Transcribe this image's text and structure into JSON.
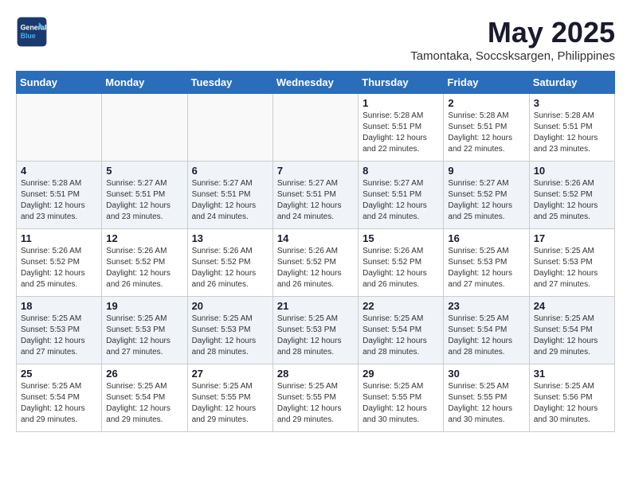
{
  "header": {
    "logo_line1": "General",
    "logo_line2": "Blue",
    "month": "May 2025",
    "location": "Tamontaka, Soccsksargen, Philippines"
  },
  "weekdays": [
    "Sunday",
    "Monday",
    "Tuesday",
    "Wednesday",
    "Thursday",
    "Friday",
    "Saturday"
  ],
  "weeks": [
    [
      {
        "day": "",
        "info": ""
      },
      {
        "day": "",
        "info": ""
      },
      {
        "day": "",
        "info": ""
      },
      {
        "day": "",
        "info": ""
      },
      {
        "day": "1",
        "info": "Sunrise: 5:28 AM\nSunset: 5:51 PM\nDaylight: 12 hours\nand 22 minutes."
      },
      {
        "day": "2",
        "info": "Sunrise: 5:28 AM\nSunset: 5:51 PM\nDaylight: 12 hours\nand 22 minutes."
      },
      {
        "day": "3",
        "info": "Sunrise: 5:28 AM\nSunset: 5:51 PM\nDaylight: 12 hours\nand 23 minutes."
      }
    ],
    [
      {
        "day": "4",
        "info": "Sunrise: 5:28 AM\nSunset: 5:51 PM\nDaylight: 12 hours\nand 23 minutes."
      },
      {
        "day": "5",
        "info": "Sunrise: 5:27 AM\nSunset: 5:51 PM\nDaylight: 12 hours\nand 23 minutes."
      },
      {
        "day": "6",
        "info": "Sunrise: 5:27 AM\nSunset: 5:51 PM\nDaylight: 12 hours\nand 24 minutes."
      },
      {
        "day": "7",
        "info": "Sunrise: 5:27 AM\nSunset: 5:51 PM\nDaylight: 12 hours\nand 24 minutes."
      },
      {
        "day": "8",
        "info": "Sunrise: 5:27 AM\nSunset: 5:51 PM\nDaylight: 12 hours\nand 24 minutes."
      },
      {
        "day": "9",
        "info": "Sunrise: 5:27 AM\nSunset: 5:52 PM\nDaylight: 12 hours\nand 25 minutes."
      },
      {
        "day": "10",
        "info": "Sunrise: 5:26 AM\nSunset: 5:52 PM\nDaylight: 12 hours\nand 25 minutes."
      }
    ],
    [
      {
        "day": "11",
        "info": "Sunrise: 5:26 AM\nSunset: 5:52 PM\nDaylight: 12 hours\nand 25 minutes."
      },
      {
        "day": "12",
        "info": "Sunrise: 5:26 AM\nSunset: 5:52 PM\nDaylight: 12 hours\nand 26 minutes."
      },
      {
        "day": "13",
        "info": "Sunrise: 5:26 AM\nSunset: 5:52 PM\nDaylight: 12 hours\nand 26 minutes."
      },
      {
        "day": "14",
        "info": "Sunrise: 5:26 AM\nSunset: 5:52 PM\nDaylight: 12 hours\nand 26 minutes."
      },
      {
        "day": "15",
        "info": "Sunrise: 5:26 AM\nSunset: 5:52 PM\nDaylight: 12 hours\nand 26 minutes."
      },
      {
        "day": "16",
        "info": "Sunrise: 5:25 AM\nSunset: 5:53 PM\nDaylight: 12 hours\nand 27 minutes."
      },
      {
        "day": "17",
        "info": "Sunrise: 5:25 AM\nSunset: 5:53 PM\nDaylight: 12 hours\nand 27 minutes."
      }
    ],
    [
      {
        "day": "18",
        "info": "Sunrise: 5:25 AM\nSunset: 5:53 PM\nDaylight: 12 hours\nand 27 minutes."
      },
      {
        "day": "19",
        "info": "Sunrise: 5:25 AM\nSunset: 5:53 PM\nDaylight: 12 hours\nand 27 minutes."
      },
      {
        "day": "20",
        "info": "Sunrise: 5:25 AM\nSunset: 5:53 PM\nDaylight: 12 hours\nand 28 minutes."
      },
      {
        "day": "21",
        "info": "Sunrise: 5:25 AM\nSunset: 5:53 PM\nDaylight: 12 hours\nand 28 minutes."
      },
      {
        "day": "22",
        "info": "Sunrise: 5:25 AM\nSunset: 5:54 PM\nDaylight: 12 hours\nand 28 minutes."
      },
      {
        "day": "23",
        "info": "Sunrise: 5:25 AM\nSunset: 5:54 PM\nDaylight: 12 hours\nand 28 minutes."
      },
      {
        "day": "24",
        "info": "Sunrise: 5:25 AM\nSunset: 5:54 PM\nDaylight: 12 hours\nand 29 minutes."
      }
    ],
    [
      {
        "day": "25",
        "info": "Sunrise: 5:25 AM\nSunset: 5:54 PM\nDaylight: 12 hours\nand 29 minutes."
      },
      {
        "day": "26",
        "info": "Sunrise: 5:25 AM\nSunset: 5:54 PM\nDaylight: 12 hours\nand 29 minutes."
      },
      {
        "day": "27",
        "info": "Sunrise: 5:25 AM\nSunset: 5:55 PM\nDaylight: 12 hours\nand 29 minutes."
      },
      {
        "day": "28",
        "info": "Sunrise: 5:25 AM\nSunset: 5:55 PM\nDaylight: 12 hours\nand 29 minutes."
      },
      {
        "day": "29",
        "info": "Sunrise: 5:25 AM\nSunset: 5:55 PM\nDaylight: 12 hours\nand 30 minutes."
      },
      {
        "day": "30",
        "info": "Sunrise: 5:25 AM\nSunset: 5:55 PM\nDaylight: 12 hours\nand 30 minutes."
      },
      {
        "day": "31",
        "info": "Sunrise: 5:25 AM\nSunset: 5:56 PM\nDaylight: 12 hours\nand 30 minutes."
      }
    ]
  ]
}
